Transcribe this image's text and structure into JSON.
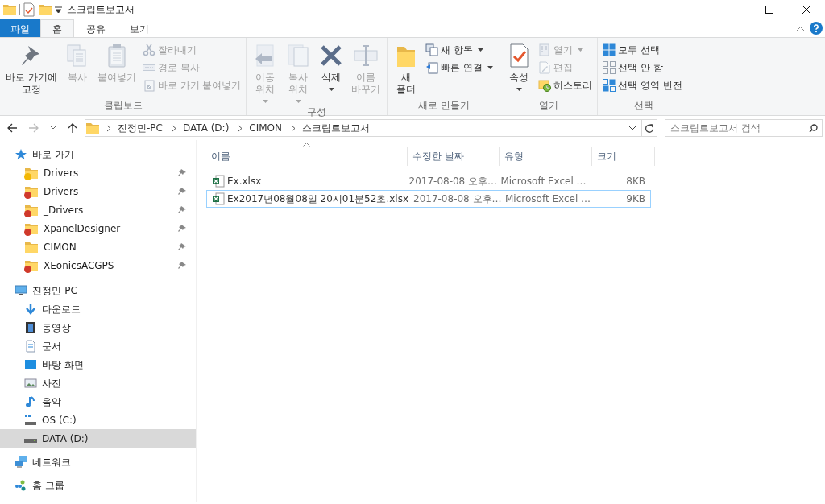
{
  "window": {
    "title": "스크립트보고서"
  },
  "ribbon_tabs": [
    {
      "label": "파일",
      "kind": "file",
      "selected": false
    },
    {
      "label": "홈",
      "kind": "tab",
      "selected": true
    },
    {
      "label": "공유",
      "kind": "tab",
      "selected": false
    },
    {
      "label": "보기",
      "kind": "tab",
      "selected": false
    }
  ],
  "ribbon_groups": [
    {
      "label": "클립보드",
      "items": [
        {
          "kind": "large",
          "lines": [
            "바로 가기에",
            "고정"
          ],
          "disabled": false,
          "dropdown": false
        },
        {
          "kind": "large",
          "lines": [
            "복사"
          ],
          "disabled": true,
          "dropdown": false
        },
        {
          "kind": "large",
          "lines": [
            "붙여넣기"
          ],
          "disabled": true,
          "dropdown": false
        },
        {
          "kind": "small",
          "lines": [
            "잘라내기"
          ],
          "disabled": true,
          "dropdown": false
        },
        {
          "kind": "small",
          "lines": [
            "경로 복사"
          ],
          "disabled": true,
          "dropdown": false
        },
        {
          "kind": "small",
          "lines": [
            "바로 가기 붙여넣기"
          ],
          "disabled": true,
          "dropdown": false
        }
      ]
    },
    {
      "label": "구성",
      "items": [
        {
          "kind": "large",
          "lines": [
            "이동",
            "위치"
          ],
          "disabled": true,
          "dropdown": true
        },
        {
          "kind": "large",
          "lines": [
            "복사",
            "위치"
          ],
          "disabled": true,
          "dropdown": true
        },
        {
          "kind": "large",
          "lines": [
            "삭제"
          ],
          "disabled": false,
          "dropdown": true
        },
        {
          "kind": "large",
          "lines": [
            "이름",
            "바꾸기"
          ],
          "disabled": true,
          "dropdown": false
        }
      ]
    },
    {
      "label": "새로 만들기",
      "items": [
        {
          "kind": "large",
          "lines": [
            "새",
            "폴더"
          ],
          "disabled": false,
          "dropdown": false
        },
        {
          "kind": "small",
          "lines": [
            "새 항목"
          ],
          "disabled": false,
          "dropdown": true
        },
        {
          "kind": "small",
          "lines": [
            "빠른 연결"
          ],
          "disabled": false,
          "dropdown": true
        }
      ]
    },
    {
      "label": "열기",
      "items": [
        {
          "kind": "large",
          "lines": [
            "속성"
          ],
          "disabled": false,
          "dropdown": true
        },
        {
          "kind": "small",
          "lines": [
            "열기"
          ],
          "disabled": true,
          "dropdown": true
        },
        {
          "kind": "small",
          "lines": [
            "편집"
          ],
          "disabled": true,
          "dropdown": false
        },
        {
          "kind": "small",
          "lines": [
            "히스토리"
          ],
          "disabled": false,
          "dropdown": false
        }
      ]
    },
    {
      "label": "선택",
      "items": [
        {
          "kind": "small",
          "lines": [
            "모두 선택"
          ],
          "disabled": false,
          "dropdown": false
        },
        {
          "kind": "small",
          "lines": [
            "선택 안 함"
          ],
          "disabled": false,
          "dropdown": false
        },
        {
          "kind": "small",
          "lines": [
            "선택 영역 반전"
          ],
          "disabled": false,
          "dropdown": false
        }
      ]
    }
  ],
  "address": {
    "path": [
      "진정민-PC",
      "DATA (D:)",
      "CIMON",
      "스크립트보고서"
    ],
    "search_placeholder": "스크립트보고서 검색"
  },
  "columns": [
    "이름",
    "수정한 날짜",
    "유형",
    "크기"
  ],
  "files": [
    {
      "name": "Ex.xlsx",
      "modified": "2017-08-08 오후…",
      "type": "Microsoft Excel …",
      "size": "8KB",
      "focused": false
    },
    {
      "name": "Ex2017년08월08일 20시01분52초.xlsx",
      "modified": "2017-08-08 오후…",
      "type": "Microsoft Excel …",
      "size": "9KB",
      "focused": true
    }
  ],
  "sidebar": [
    {
      "label": "바로 가기",
      "kind": "quick",
      "children": [
        {
          "label": "Drivers",
          "color": "#f2b705",
          "pinned": true,
          "selected": false
        },
        {
          "label": "Drivers",
          "color": "#d0392b",
          "pinned": true,
          "selected": false
        },
        {
          "label": "_Drivers",
          "color": "#d0392b",
          "pinned": true,
          "selected": false
        },
        {
          "label": "XpanelDesigner",
          "color": "#d0392b",
          "pinned": true,
          "selected": false
        },
        {
          "label": "CIMON",
          "pinned": true,
          "selected": false
        },
        {
          "label": "XEonicsACGPS",
          "color": "#d0392b",
          "pinned": true,
          "selected": false
        }
      ]
    },
    {
      "label": "진정민-PC",
      "kind": "pc",
      "children": [
        {
          "label": "다운로드",
          "selected": false
        },
        {
          "label": "동영상",
          "selected": false
        },
        {
          "label": "문서",
          "selected": false
        },
        {
          "label": "바탕 화면",
          "selected": false
        },
        {
          "label": "사진",
          "selected": false
        },
        {
          "label": "음악",
          "selected": false
        },
        {
          "label": "OS (C:)",
          "selected": false
        },
        {
          "label": "DATA (D:)",
          "selected": true
        }
      ]
    },
    {
      "label": "네트워크",
      "kind": "network"
    },
    {
      "label": "홈 그룹",
      "kind": "homegroup"
    }
  ]
}
